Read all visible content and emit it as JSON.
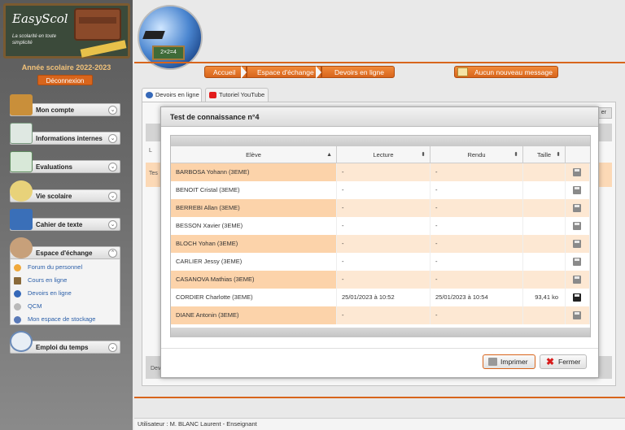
{
  "sidebar": {
    "logo_title": "EasyScol",
    "logo_tagline": "La scolarité en toute simplicité",
    "school_year": "Année scolaire 2022-2023",
    "logout_label": "Déconnexion",
    "menu": [
      {
        "label": "Mon compte",
        "icon": "account-icon"
      },
      {
        "label": "Informations internes",
        "icon": "newspaper-icon"
      },
      {
        "label": "Evaluations",
        "icon": "evaluations-icon"
      },
      {
        "label": "Vie scolaire",
        "icon": "school-life-icon"
      },
      {
        "label": "Cahier de texte",
        "icon": "notebook-icon"
      },
      {
        "label": "Espace d'échange",
        "icon": "users-icon"
      },
      {
        "label": "Emploi du temps",
        "icon": "clock-icon"
      }
    ],
    "submenu": [
      {
        "label": "Forum du personnel",
        "icon": "forum-icon"
      },
      {
        "label": "Cours en ligne",
        "icon": "books-icon"
      },
      {
        "label": "Devoirs en ligne",
        "icon": "globe-icon"
      },
      {
        "label": "QCM",
        "icon": "qcm-icon"
      },
      {
        "label": "Mon espace de stockage",
        "icon": "storage-icon"
      }
    ]
  },
  "header": {
    "globe_board_text": "2×2=4",
    "breadcrumb": [
      "Accueil",
      "Espace d'échange",
      "Devoirs en ligne"
    ],
    "messages_label": "Aucun nouveau message"
  },
  "tabs": [
    {
      "label": "Devoirs en ligne"
    },
    {
      "label": "Tutoriel YouTube"
    }
  ],
  "background": {
    "filter_btn": "er",
    "row_text": "Tes",
    "footer_text": "Dev",
    "header_text": "L"
  },
  "modal": {
    "title": "Test de connaissance n°4",
    "columns": [
      "Elève",
      "Lecture",
      "Rendu",
      "Taille"
    ],
    "rows": [
      {
        "name": "BARBOSA Yohann (3EME)",
        "lecture": "-",
        "rendu": "-",
        "taille": "",
        "submitted": false
      },
      {
        "name": "BENOIT Cristal (3EME)",
        "lecture": "-",
        "rendu": "-",
        "taille": "",
        "submitted": false
      },
      {
        "name": "BERREBI Allan (3EME)",
        "lecture": "-",
        "rendu": "-",
        "taille": "",
        "submitted": false
      },
      {
        "name": "BESSON Xavier (3EME)",
        "lecture": "-",
        "rendu": "-",
        "taille": "",
        "submitted": false
      },
      {
        "name": "BLOCH Yohan (3EME)",
        "lecture": "-",
        "rendu": "-",
        "taille": "",
        "submitted": false
      },
      {
        "name": "CARLIER Jessy (3EME)",
        "lecture": "-",
        "rendu": "-",
        "taille": "",
        "submitted": false
      },
      {
        "name": "CASANOVA Mathias (3EME)",
        "lecture": "-",
        "rendu": "-",
        "taille": "",
        "submitted": false
      },
      {
        "name": "CORDIER Charlotte (3EME)",
        "lecture": "25/01/2023 à 10:52",
        "rendu": "25/01/2023 à 10:54",
        "taille": "93,41 ko",
        "submitted": true
      },
      {
        "name": "DIANE Antonin (3EME)",
        "lecture": "-",
        "rendu": "-",
        "taille": "",
        "submitted": false
      }
    ],
    "print_label": "Imprimer",
    "close_label": "Fermer"
  },
  "status_bar": "Utilisateur : M. BLANC Laurent - Enseignant",
  "colors": {
    "accent": "#d8651c",
    "row_highlight": "#fcd3aa"
  }
}
